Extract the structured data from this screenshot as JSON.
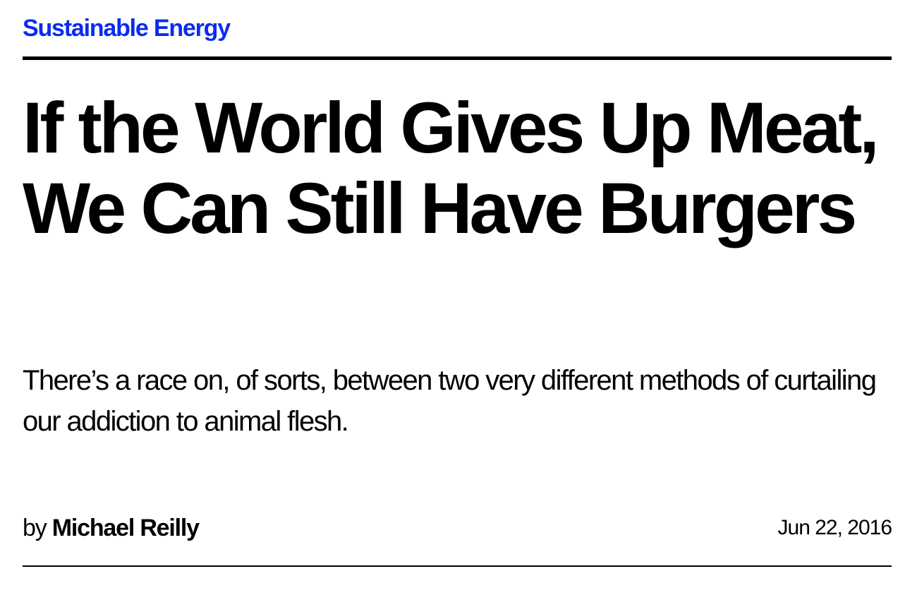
{
  "article": {
    "category": "Sustainable Energy",
    "headline": "If the World Gives Up Meat, We Can Still Have Burgers",
    "dek": "There’s a race on, of sorts, between two very different methods of curtailing our addiction to animal flesh.",
    "byline_prefix": "by",
    "author": "Michael Reilly",
    "date": "Jun 22, 2016"
  },
  "colors": {
    "accent": "#0a2cf0",
    "text": "#000000",
    "background": "#ffffff"
  }
}
